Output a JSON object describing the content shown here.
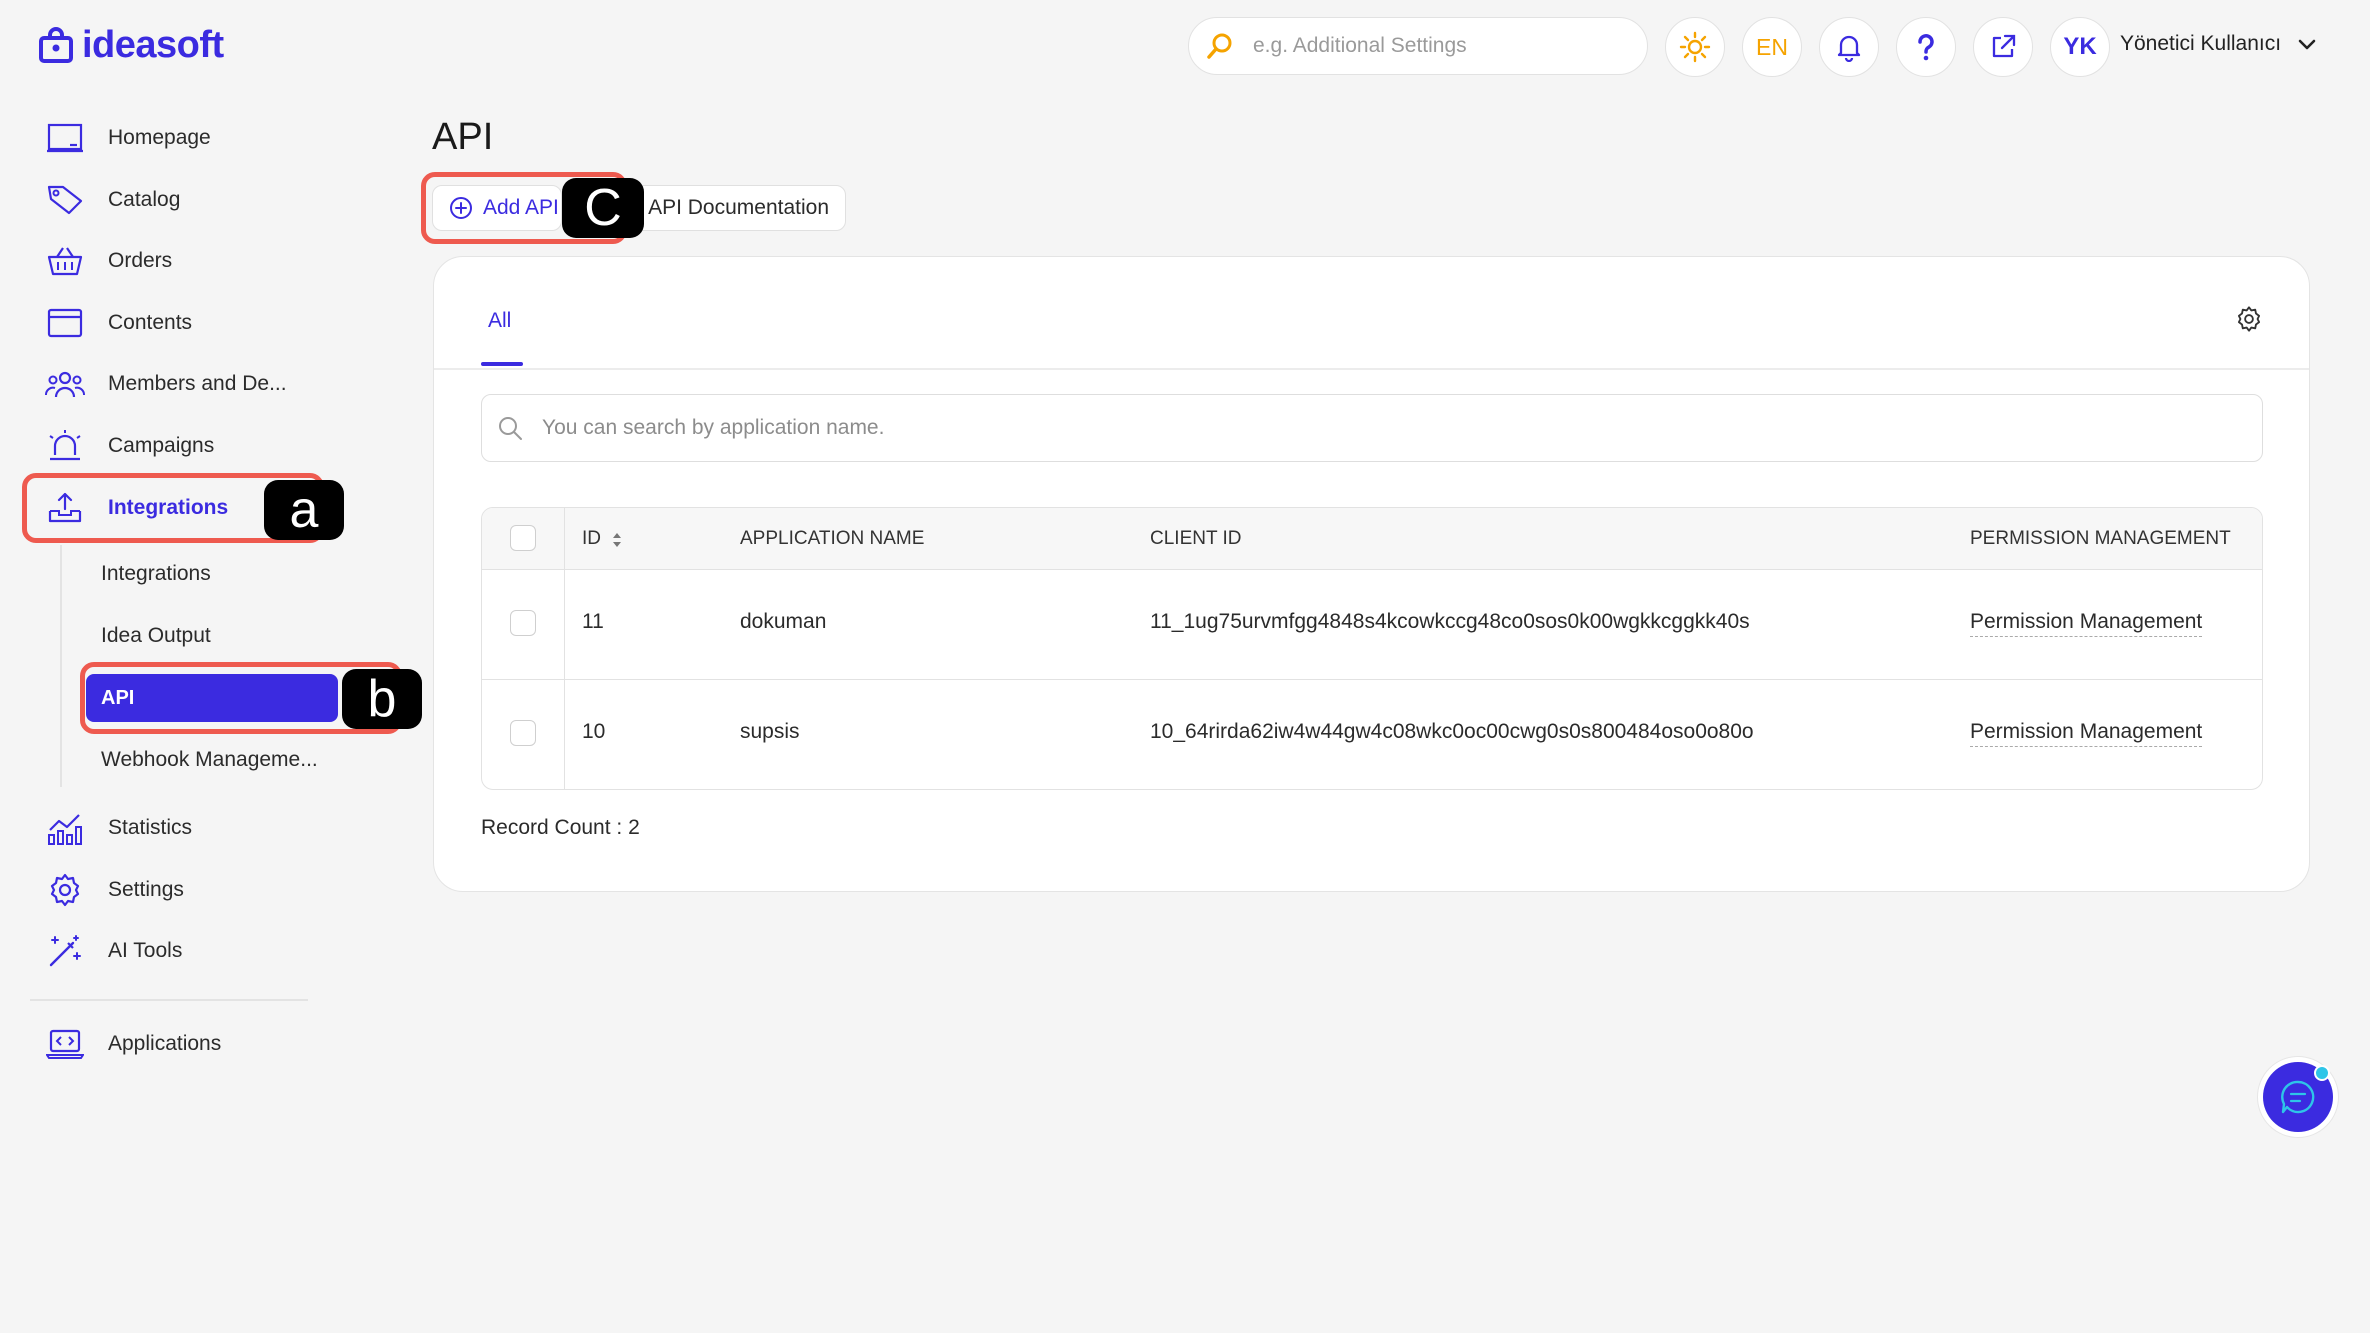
{
  "brand": {
    "name": "ideasoft",
    "accent": "#3b2be0"
  },
  "header": {
    "search_placeholder": "e.g. Additional Settings",
    "language": "EN",
    "user_initials": "YK",
    "user_name": "Yönetici Kullanıcı"
  },
  "sidebar": {
    "items": [
      {
        "label": "Homepage",
        "icon": "monitor-icon"
      },
      {
        "label": "Catalog",
        "icon": "tag-icon"
      },
      {
        "label": "Orders",
        "icon": "basket-icon"
      },
      {
        "label": "Contents",
        "icon": "browser-window-icon"
      },
      {
        "label": "Members and De...",
        "icon": "users-icon"
      },
      {
        "label": "Campaigns",
        "icon": "siren-icon"
      },
      {
        "label": "Integrations",
        "icon": "upload-tray-icon"
      },
      {
        "label": "Statistics",
        "icon": "bar-chart-icon"
      },
      {
        "label": "Settings",
        "icon": "gear-icon"
      },
      {
        "label": "AI Tools",
        "icon": "magic-wand-icon"
      },
      {
        "label": "Applications",
        "icon": "laptop-code-icon"
      }
    ],
    "sub_items": [
      "Integrations",
      "Idea Output",
      "API",
      "Webhook Manageme..."
    ]
  },
  "annotations": {
    "a": "a",
    "b": "b",
    "c": "C",
    "highlight_color": "#ee5a4f"
  },
  "main": {
    "title": "API",
    "add_button": "Add API",
    "doc_button": "API Documentation",
    "tabs": [
      "All"
    ],
    "search_placeholder": "You can search by application name.",
    "table": {
      "headers": [
        "ID",
        "APPLICATION NAME",
        "CLIENT ID",
        "PERMISSION MANAGEMENT"
      ],
      "rows": [
        {
          "id": "11",
          "name": "dokuman",
          "client_id": "11_1ug75urvmfgg4848s4kcowkccg48co0sos0k00wgkkcggkk40s",
          "permission": "Permission Management"
        },
        {
          "id": "10",
          "name": "supsis",
          "client_id": "10_64rirda62iw4w44gw4c08wkc0oc00cwg0s0s800484oso0o80o",
          "permission": "Permission Management"
        }
      ]
    },
    "record_count": "Record Count : 2"
  }
}
